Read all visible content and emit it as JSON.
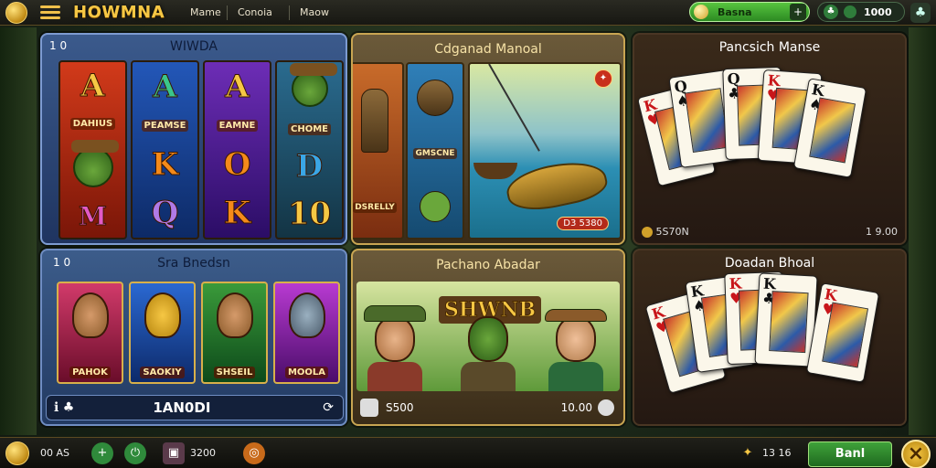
{
  "header": {
    "brand": "HOWMNA",
    "nav": [
      "Mame",
      "Conoia",
      "Maow"
    ],
    "balance_label": "Basna",
    "balance_add": "+",
    "gems": "1000",
    "menu_icon": "hamburger-icon"
  },
  "slots": {
    "tag": "1 0",
    "title": "WIWDA",
    "reels": [
      {
        "top": "A",
        "cap": "DAHIUS",
        "bottom_cap": "M"
      },
      {
        "top": "A",
        "cap": "PEAMSE",
        "mid": "K",
        "bottom": "Q"
      },
      {
        "top": "A",
        "cap": "EAMNE",
        "mid": "O",
        "bottom": "K"
      },
      {
        "top": "",
        "cap": "CHOME",
        "mid": "D",
        "bottom": "10"
      }
    ]
  },
  "fishing": {
    "title": "Cdganad Manoal",
    "reel1_cap": "DSRELLY",
    "reel2_cap": "GMSCNE",
    "scene_badge": "D3 5380"
  },
  "cards1": {
    "title": "Pancsich Manse",
    "left_value": "5S70N",
    "right_value": "1 9.00"
  },
  "sda": {
    "tag": "1 0",
    "title": "Sra Bnedsn",
    "tiles": [
      "PAHOK",
      "SAOKIY",
      "SHSEIL",
      "MOOLA"
    ],
    "bar_value": "1AN0DI"
  },
  "pachinko": {
    "title": "Pachano Abadar",
    "logo": "SHWNB",
    "left_value": "S500",
    "right_value": "10.00"
  },
  "cards2": {
    "title": "Doadan Bhoal"
  },
  "footer": {
    "stat1": "00 AS",
    "stat2": "3200",
    "stat3": "13 16",
    "play_label": "Banl",
    "close_label": "×"
  },
  "colors": {
    "accent_gold": "#f6c744",
    "accent_green": "#3fa23a",
    "card_red": "#c8161a"
  }
}
